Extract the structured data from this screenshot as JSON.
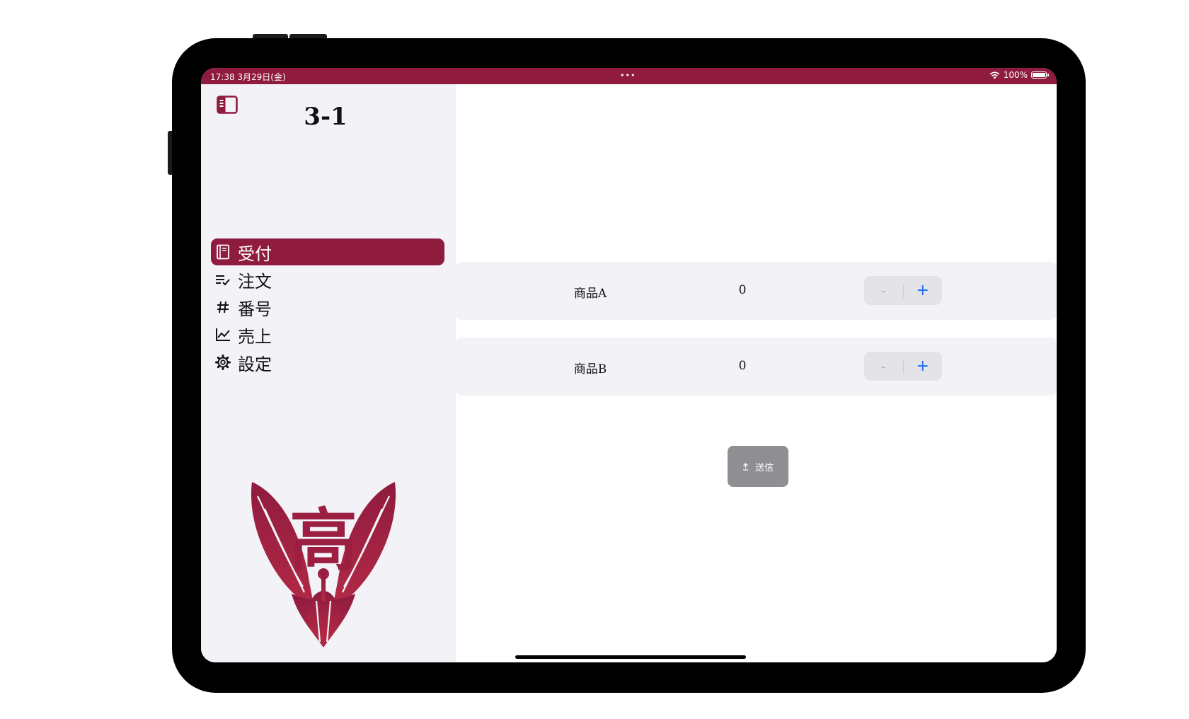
{
  "colors": {
    "brand": "#8f1b3f",
    "accent_blue": "#1e6fe6",
    "send_button_bg": "#8e8e93",
    "sidebar_bg": "#f2f2f7"
  },
  "status_bar": {
    "time_date": "17:38   3月29日(金)",
    "multitask_dots": "•••",
    "battery_percent": "100%",
    "battery_level": 1.0
  },
  "sidebar": {
    "toggle_icon": "sidebar-toggle-icon",
    "title": "3-1",
    "items": [
      {
        "label": "受付",
        "icon": "book-icon",
        "active": true
      },
      {
        "label": "注文",
        "icon": "list-check-icon",
        "active": false
      },
      {
        "label": "番号",
        "icon": "hashtag-icon",
        "active": false
      },
      {
        "label": "売上",
        "icon": "line-chart-icon",
        "active": false
      },
      {
        "label": "設定",
        "icon": "gear-icon",
        "active": false
      }
    ],
    "emblem_text": "高"
  },
  "main": {
    "products": [
      {
        "name": "商品A",
        "quantity": "0",
        "minus": "-",
        "plus": "+"
      },
      {
        "name": "商品B",
        "quantity": "0",
        "minus": "-",
        "plus": "+"
      }
    ],
    "send_button": {
      "icon": "upload-icon",
      "label": "送信"
    }
  }
}
